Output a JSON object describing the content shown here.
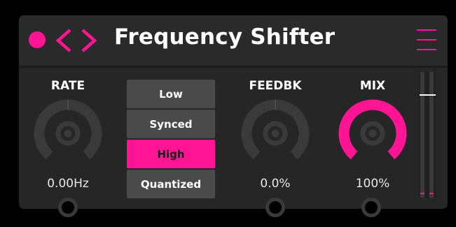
{
  "window": {
    "title": "Frequency Shifter",
    "accent_color": "#ff1493",
    "icons": [
      "record-dot-icon",
      "chevron-left-icon",
      "chevron-right-icon",
      "hamburger-menu-icon"
    ]
  },
  "knobs": {
    "rate": {
      "label": "RATE",
      "value_text": "0.00Hz",
      "level": 0.5,
      "style": "bipolar"
    },
    "feedback": {
      "label": "FEEDBK",
      "value_text": "0.0%",
      "level": 0.5,
      "style": "bipolar"
    },
    "mix": {
      "label": "MIX",
      "value_text": "100%",
      "level": 1.0,
      "style": "unipolar"
    }
  },
  "mode": {
    "options": [
      "Low",
      "Synced",
      "High",
      "Quantized"
    ],
    "selected": "High"
  },
  "output_meter": {
    "peak_level": 0.82
  }
}
